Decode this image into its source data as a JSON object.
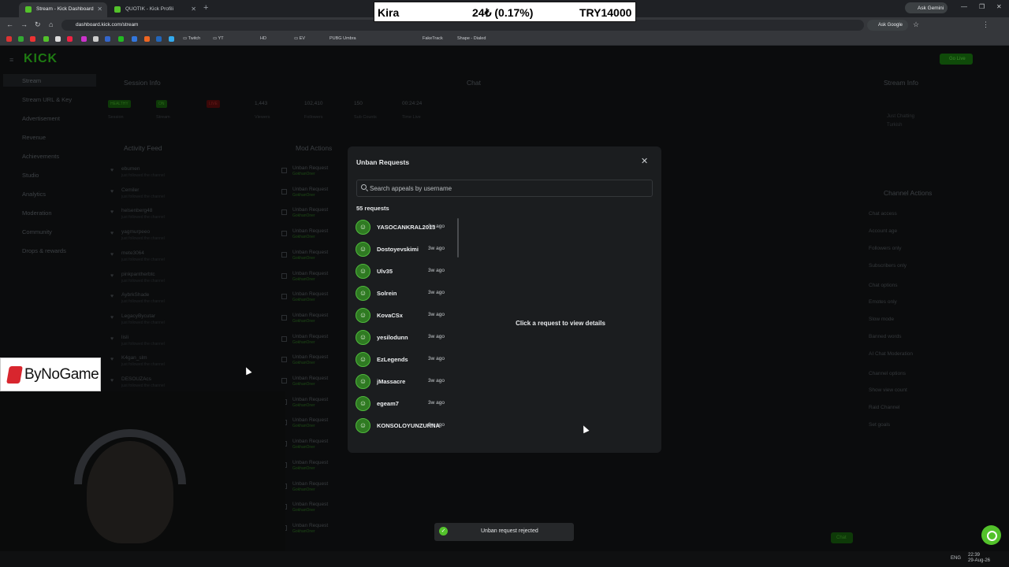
{
  "browser": {
    "tabs": [
      {
        "title": "Stream - Kick Dashboard",
        "active": true
      },
      {
        "title": "QUOTIK - Kick Profili",
        "active": false
      }
    ],
    "url": "dashboard.kick.com/stream",
    "ask_gemini": "Ask Gemini",
    "ask_google": "Ask Google",
    "bookmarks": [
      "Twitch",
      "YT",
      "HD",
      "EV",
      "PUBG Umbra",
      "FakeTrack",
      "Shape - Dialed"
    ]
  },
  "ticker": {
    "name": "Kira",
    "change": "24₺ (0.17%)",
    "price": "TRY14000"
  },
  "brand": {
    "logo": "KICK",
    "go_live": "Go Live"
  },
  "sidebar": {
    "items": [
      "Stream",
      "Stream URL & Key",
      "Advertisement",
      "Revenue",
      "Achievements",
      "Studio",
      "Analytics",
      "Moderation",
      "Community",
      "Drops & rewards"
    ]
  },
  "session": {
    "title": "Session Info",
    "stats": [
      "1,443",
      "102,410",
      "150",
      "00:24:24"
    ],
    "labels": [
      "Session",
      "Stream",
      "Viewers",
      "Followers",
      "Sub Counts",
      "Time Live"
    ],
    "badges": [
      "HEALTHY",
      "ON",
      "LIVE"
    ]
  },
  "activity": {
    "title": "Activity Feed",
    "rows": [
      {
        "name": "ebumen",
        "desc": "just followed the channel"
      },
      {
        "name": "Cemiler",
        "desc": "just followed the channel"
      },
      {
        "name": "helsenberg48",
        "desc": "just followed the channel"
      },
      {
        "name": "yagmurpeeo",
        "desc": "just followed the channel"
      },
      {
        "name": "mete3064",
        "desc": "just followed the channel"
      },
      {
        "name": "pinkpantherbtc",
        "desc": "just followed the channel"
      },
      {
        "name": "AybrkShade",
        "desc": "just followed the channel"
      },
      {
        "name": "LegacyBycutar",
        "desc": "just followed the channel"
      },
      {
        "name": "lisli",
        "desc": "just followed the channel"
      },
      {
        "name": "K4gan_slm",
        "desc": "just followed the channel"
      },
      {
        "name": "DESOUZAcs",
        "desc": "just followed the channel"
      }
    ]
  },
  "mod_actions": {
    "title": "Mod Actions",
    "row_label": "Unban Request",
    "row_user": "GokhanOner"
  },
  "chat": {
    "title": "Chat",
    "send": "Chat"
  },
  "stream_info": {
    "title": "Stream Info",
    "category": "Just Chatting",
    "language": "Turkish"
  },
  "channel_actions": {
    "title": "Channel Actions",
    "items": [
      "Chat access",
      "Account age",
      "Followers only",
      "Subscribers only",
      "Chat options",
      "Emotes only",
      "Slow mode",
      "Banned words",
      "AI Chat Moderation",
      "Channel options",
      "Show view count",
      "Raid Channel",
      "Set goals"
    ]
  },
  "modal": {
    "title": "Unban Requests",
    "search_placeholder": "Search appeals by username",
    "count_label": "55 requests",
    "empty_message": "Click a request to view details",
    "requests": [
      {
        "name": "YASOCANKRAL2013",
        "time": "3w ago"
      },
      {
        "name": "Dostoyevskimi",
        "time": "3w ago"
      },
      {
        "name": "Ulv35",
        "time": "3w ago"
      },
      {
        "name": "Solrein",
        "time": "3w ago"
      },
      {
        "name": "KovaCSx",
        "time": "3w ago"
      },
      {
        "name": "yesilodunn",
        "time": "3w ago"
      },
      {
        "name": "EzLegends",
        "time": "3w ago"
      },
      {
        "name": "jMassacre",
        "time": "3w ago"
      },
      {
        "name": "egeam7",
        "time": "3w ago"
      },
      {
        "name": "KONSOLOYUNZURNA",
        "time": "3w ago"
      }
    ]
  },
  "toast": {
    "text": "Unban request rejected"
  },
  "overlay": {
    "sponsor": "ByNoGame"
  },
  "taskbar": {
    "time": "22:39",
    "date": "29-Aug-26",
    "lang": "ENG"
  },
  "colors": {
    "brand_green": "#53c22b",
    "modal_bg": "#1b1d1f"
  }
}
